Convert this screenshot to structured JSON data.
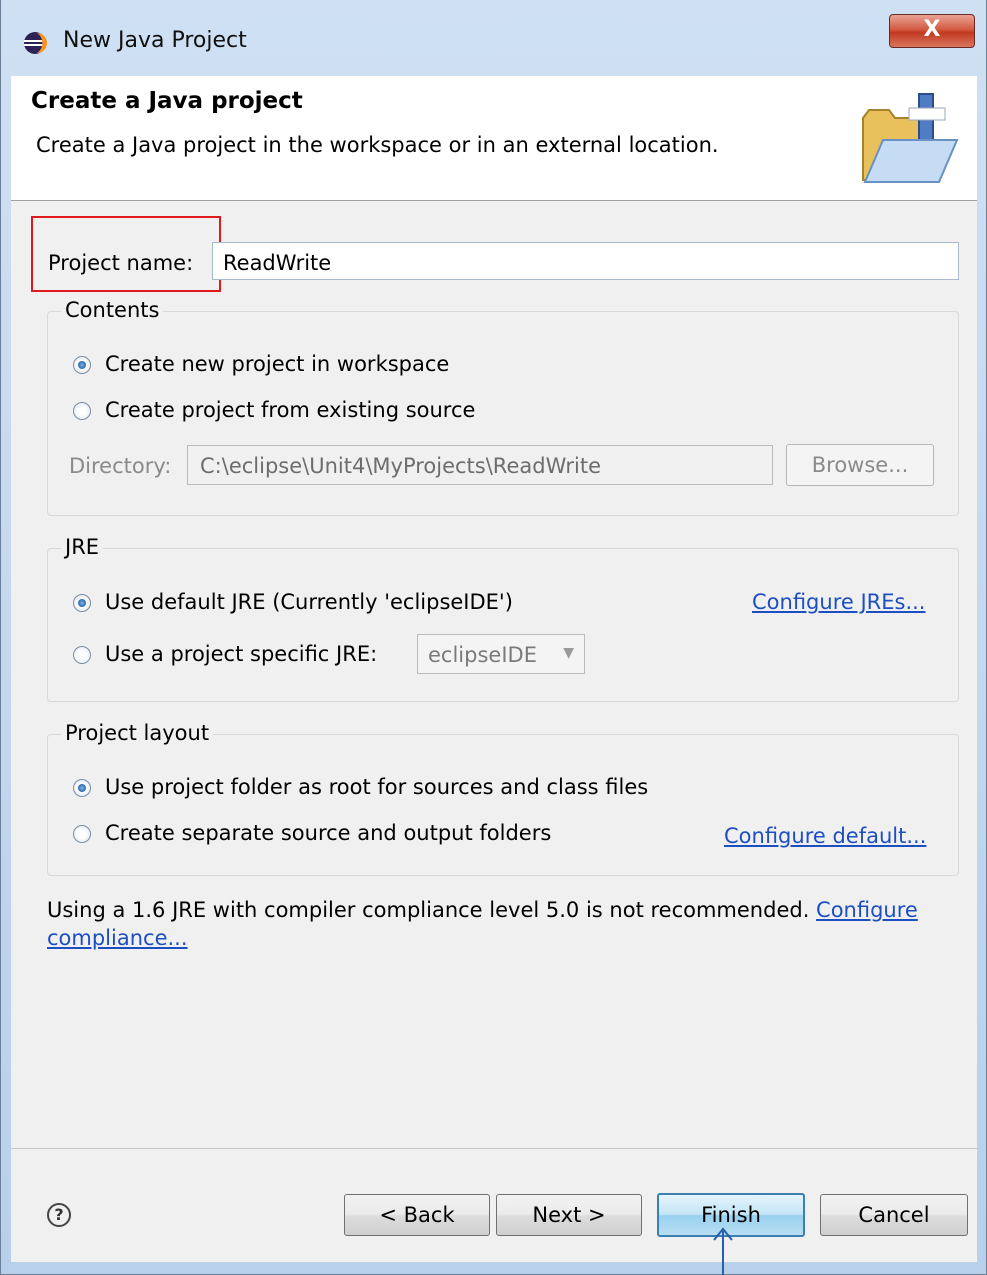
{
  "window": {
    "title": "New Java Project",
    "close_label": "X"
  },
  "header": {
    "title": "Create a Java project",
    "description": "Create a Java project in the workspace or in an external location."
  },
  "project_name": {
    "label": "Project name:",
    "value": "ReadWrite"
  },
  "contents": {
    "label": "Contents",
    "option_new": "Create new project in workspace",
    "option_existing": "Create project from existing source",
    "selected": "option_new",
    "directory_label": "Directory:",
    "directory_value": "C:\\eclipse\\Unit4\\MyProjects\\ReadWrite",
    "browse_label": "Browse..."
  },
  "jre": {
    "label": "JRE",
    "option_default": "Use default JRE (Currently 'eclipseIDE')",
    "option_specific": "Use a project specific JRE:",
    "selected": "option_default",
    "select_value": "eclipseIDE",
    "configure_link": "Configure JREs..."
  },
  "layout": {
    "label": "Project layout",
    "option_root": "Use project folder as root for sources and class files",
    "option_separate": "Create separate source and output folders",
    "selected": "option_root",
    "configure_link": "Configure default..."
  },
  "warning": {
    "text": "Using a 1.6 JRE with compiler compliance level 5.0 is not recommended. ",
    "link": "Configure compliance..."
  },
  "footer": {
    "help": "?",
    "back": "< Back",
    "next": "Next >",
    "finish": "Finish",
    "cancel": "Cancel"
  },
  "colors": {
    "highlight_box": "#e0191d",
    "link": "#1e4fc2",
    "arrow": "#2a5ea8"
  }
}
